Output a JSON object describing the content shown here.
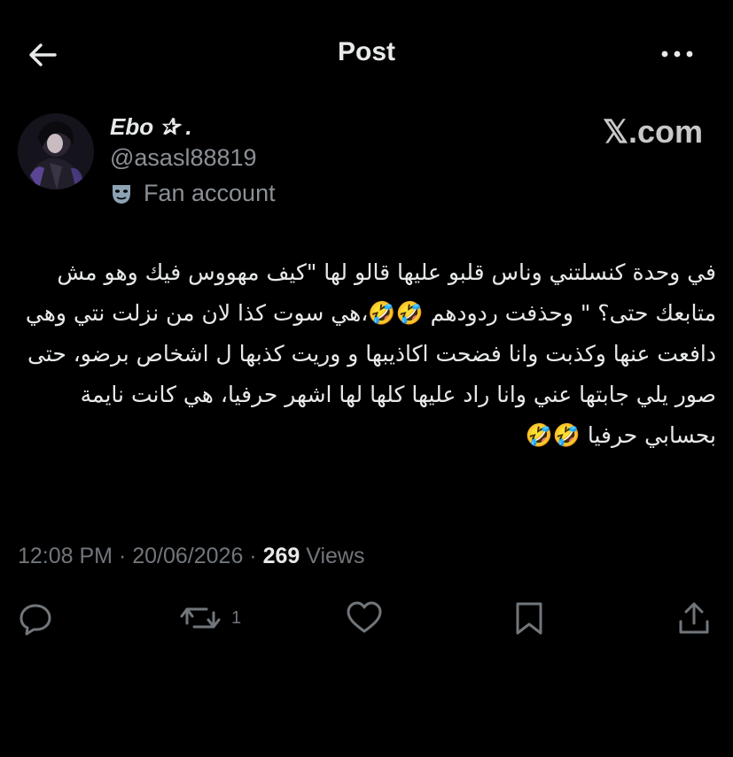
{
  "header": {
    "title": "Post",
    "back_icon": "arrow-left-icon",
    "more_icon": "more-horizontal-icon"
  },
  "author": {
    "name": "Ebo ✰ .",
    "handle": "@asasl88819",
    "label": "Fan account",
    "label_icon": "mask-icon"
  },
  "watermark": "𝕏.com",
  "post": {
    "text": "في وحدة كنسلتني وناس قلبو عليها قالو لها \"كيف مهووس فيك وهو مش متابعك حتى؟ \" وحذفت ردودهم 🤣🤣،هي سوت كذا لان من نزلت نتي وهي دافعت عنها وكذبت وانا فضحت اكاذيبها و وريت كذبها ل اشخاص برضو، حتى صور يلي جابتها عني وانا راد عليها كلها لها اشهر حرفيا، هي كانت نايمة بحسابي حرفيا 🤣🤣"
  },
  "meta": {
    "time": "12:08 PM",
    "date": "20/06/2026",
    "views_count": "269",
    "views_label": "Views",
    "separator": " · "
  },
  "actions": {
    "reply_icon": "reply-icon",
    "repost_icon": "repost-icon",
    "repost_count": "1",
    "like_icon": "heart-icon",
    "bookmark_icon": "bookmark-icon",
    "share_icon": "share-icon"
  },
  "colors": {
    "background": "#000000",
    "text_primary": "#e7e9ea",
    "text_secondary": "#71767b"
  }
}
